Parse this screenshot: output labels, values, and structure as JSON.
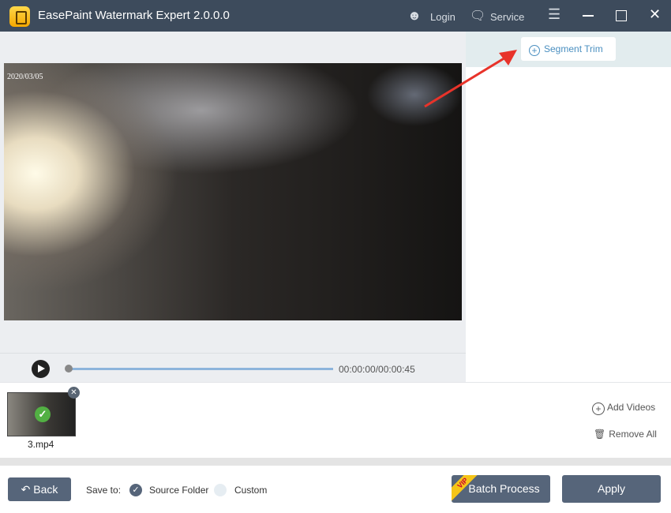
{
  "app": {
    "title": "EasePaint Watermark Expert  2.0.0.0",
    "login": "Login",
    "service": "Service"
  },
  "preview": {
    "date_stamp": "2020/03/05",
    "time": "00:00:00/00:00:45",
    "progress": 0
  },
  "toolbar": {
    "segment_trim": "Segment Trim"
  },
  "files": [
    {
      "name": "3.mp4",
      "checked": true
    }
  ],
  "actions": {
    "add_videos": "Add Videos",
    "remove_all": "Remove All"
  },
  "footer": {
    "back": "Back",
    "save_to": "Save to:",
    "source_folder": "Source Folder",
    "custom": "Custom",
    "selected": "Source Folder",
    "batch": "Batch Process",
    "vip": "VIP",
    "apply": "Apply"
  },
  "colors": {
    "titlebar": "#3d4b5c",
    "button": "#56657a",
    "accent": "#4a8fc0",
    "arrow": "#e8332a"
  }
}
